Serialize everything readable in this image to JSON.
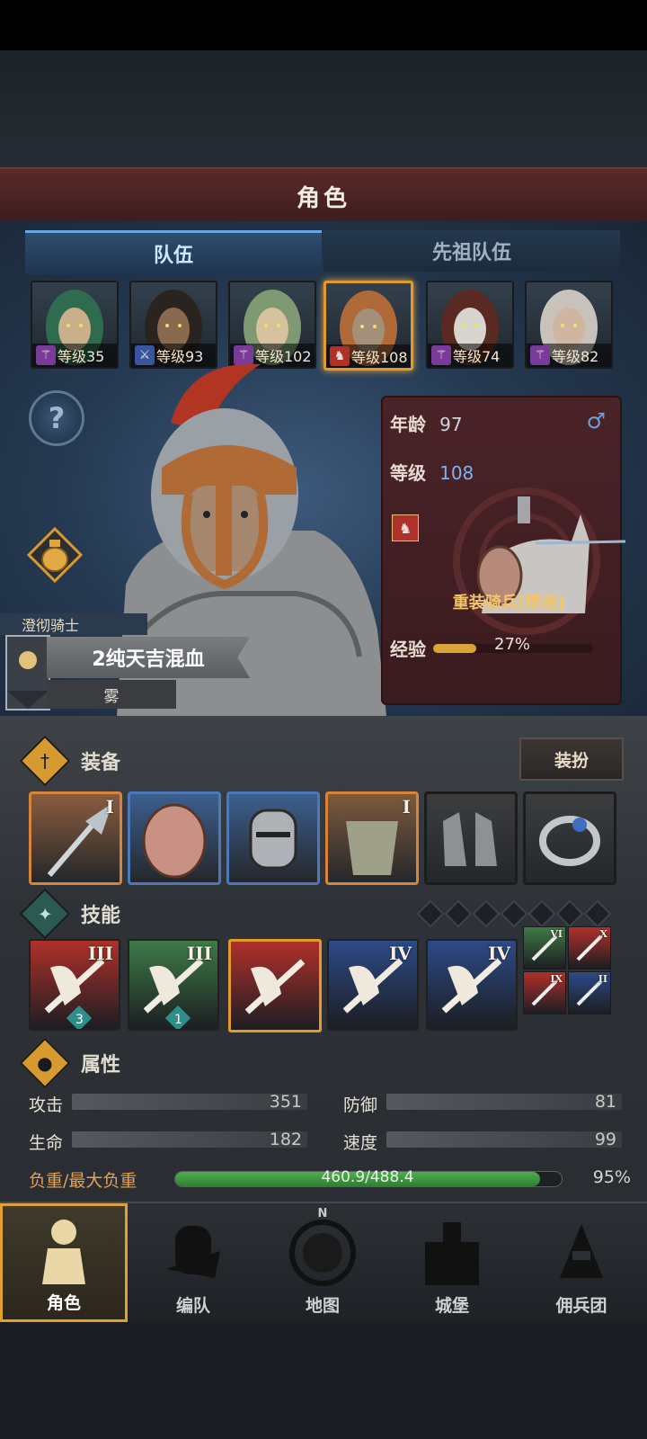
{
  "title": "角色",
  "tabs": [
    {
      "label": "队伍",
      "active": true
    },
    {
      "label": "先祖队伍",
      "active": false
    }
  ],
  "party": [
    {
      "level": "等级35",
      "class_icon": "staff-icon",
      "class_color": "#7a3a9a",
      "hair": "#2f6b4f",
      "skin": "#c9b08a",
      "selected": false
    },
    {
      "level": "等级93",
      "class_icon": "sword-icon",
      "class_color": "#3a55a0",
      "hair": "#2a2420",
      "skin": "#8a6a4e",
      "selected": false
    },
    {
      "level": "等级102",
      "class_icon": "staff-icon",
      "class_color": "#7a3a9a",
      "hair": "#7f9a72",
      "skin": "#d7c2a0",
      "selected": false
    },
    {
      "level": "等级108",
      "class_icon": "horse-icon",
      "class_color": "#b0302a",
      "hair": "#b06a3a",
      "skin": "#a4907a",
      "selected": true
    },
    {
      "level": "等级74",
      "class_icon": "staff-icon",
      "class_color": "#7a3a9a",
      "hair": "#5a2a22",
      "skin": "#d8d4ce",
      "selected": false
    },
    {
      "level": "等级82",
      "class_icon": "staff-icon",
      "class_color": "#7a3a9a",
      "hair": "#c7c3bb",
      "skin": "#d0b6a0",
      "selected": false
    }
  ],
  "hero": {
    "class_title": "澄彻骑士",
    "name": "2纯天吉混血",
    "subtitle": "雾"
  },
  "stats_card": {
    "age_label": "年龄",
    "age": "97",
    "gender_icon": "male-icon",
    "level_label": "等级",
    "level": "108",
    "unit_name": "重装骑兵[精通]",
    "exp_label": "经验",
    "exp_percent": "27%",
    "exp_fraction": 0.27
  },
  "equipment": {
    "title": "装备",
    "dress_button": "装扮",
    "items": [
      {
        "name": "halberd",
        "rank": "I",
        "border": "#d7833a",
        "bg": "#8a5c3e"
      },
      {
        "name": "shield",
        "rank": "",
        "border": "#4d79b8",
        "bg": "#3c5f8e"
      },
      {
        "name": "great-helm",
        "rank": "",
        "border": "#4d79b8",
        "bg": "#3c5f8e"
      },
      {
        "name": "plate-armor",
        "rank": "I",
        "border": "#d7833a",
        "bg": "#7e5a3c"
      },
      {
        "name": "greaves",
        "rank": "",
        "border": "#1c1c1c",
        "bg": "#3c3d3f"
      },
      {
        "name": "ring",
        "rank": "",
        "border": "#1c1c1c",
        "bg": "#3c3d3f"
      }
    ]
  },
  "skills": {
    "title": "技能",
    "slots_empty": 7,
    "items": [
      {
        "rank": "III",
        "bg": "#b0302a",
        "badge": "3"
      },
      {
        "rank": "III",
        "bg": "#3e7a45",
        "badge": "1"
      },
      {
        "rank": "",
        "bg": "#b0302a",
        "badge": ""
      },
      {
        "rank": "IV",
        "bg": "#2c4a86",
        "badge": ""
      },
      {
        "rank": "IV",
        "bg": "#2c4a86",
        "badge": ""
      }
    ],
    "small": [
      {
        "rank": "VI",
        "bg": "#3e7a45"
      },
      {
        "rank": "X",
        "bg": "#b0302a"
      },
      {
        "rank": "IX",
        "bg": "#b0302a"
      },
      {
        "rank": "II",
        "bg": "#2c4a86"
      }
    ]
  },
  "attributes": {
    "title": "属性",
    "attack_label": "攻击",
    "attack": "351",
    "defense_label": "防御",
    "defense": "81",
    "hp_label": "生命",
    "hp": "182",
    "speed_label": "速度",
    "speed": "99",
    "load_label": "负重/最大负重",
    "load_value": "460.9/488.4",
    "load_percent": "95%",
    "load_fraction": 0.944
  },
  "nav": [
    {
      "label": "角色",
      "icon": "knight-icon",
      "active": true
    },
    {
      "label": "编队",
      "icon": "helmet-icon",
      "active": false
    },
    {
      "label": "地图",
      "icon": "compass-map-icon",
      "active": false,
      "compass": "N"
    },
    {
      "label": "城堡",
      "icon": "castle-icon",
      "active": false
    },
    {
      "label": "佣兵团",
      "icon": "mercenary-icon",
      "active": false
    }
  ]
}
